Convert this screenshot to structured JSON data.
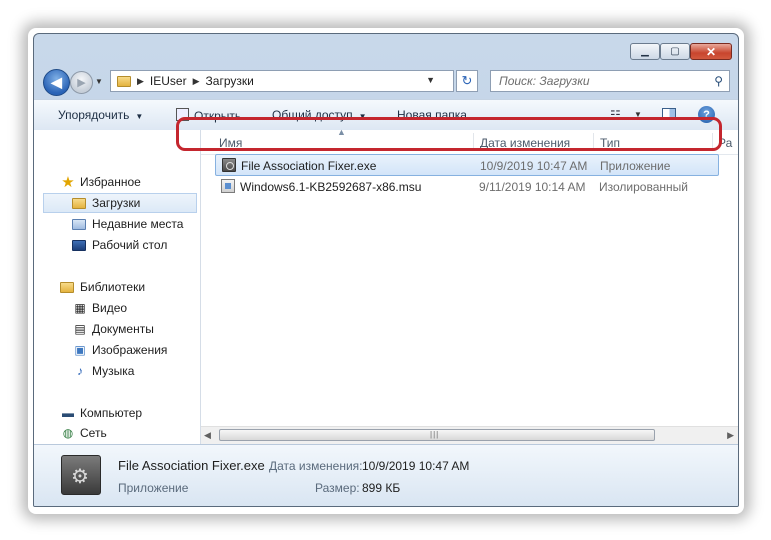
{
  "window": {
    "buttons": {
      "minimize": "▁",
      "maximize": "▢",
      "close": "✕"
    }
  },
  "nav": {
    "back": "◀",
    "forward": "▶",
    "dropdown": "▼",
    "breadcrumb": [
      "IEUser",
      "Загрузки"
    ],
    "refresh": "↻",
    "search_placeholder": "Поиск: Загрузки"
  },
  "toolbar": {
    "organize": "Упорядочить",
    "open": "Открыть",
    "share": "Общий доступ",
    "new_folder": "Новая папка"
  },
  "sidebar": {
    "favorites": {
      "label": "Избранное",
      "items": [
        "Загрузки",
        "Недавние места",
        "Рабочий стол"
      ]
    },
    "libraries": {
      "label": "Библиотеки",
      "items": [
        "Видео",
        "Документы",
        "Изображения",
        "Музыка"
      ]
    },
    "computer": "Компьютер",
    "network": "Сеть"
  },
  "columns": {
    "name": "Имя",
    "date": "Дата изменения",
    "type": "Тип",
    "size": "Ра"
  },
  "files": [
    {
      "name": "File Association Fixer.exe",
      "date": "10/9/2019 10:47 AM",
      "type": "Приложение",
      "selected": true
    },
    {
      "name": "Windows6.1-KB2592687-x86.msu",
      "date": "9/11/2019 10:14 AM",
      "type": "Изолированный",
      "selected": false
    }
  ],
  "details": {
    "name": "File Association Fixer.exe",
    "type": "Приложение",
    "date_label": "Дата изменения:",
    "date_value": "10/9/2019 10:47 AM",
    "size_label": "Размер:",
    "size_value": "899 КБ"
  },
  "colors": {
    "highlight": "#c4262e",
    "selection": "#d3e5f9"
  }
}
